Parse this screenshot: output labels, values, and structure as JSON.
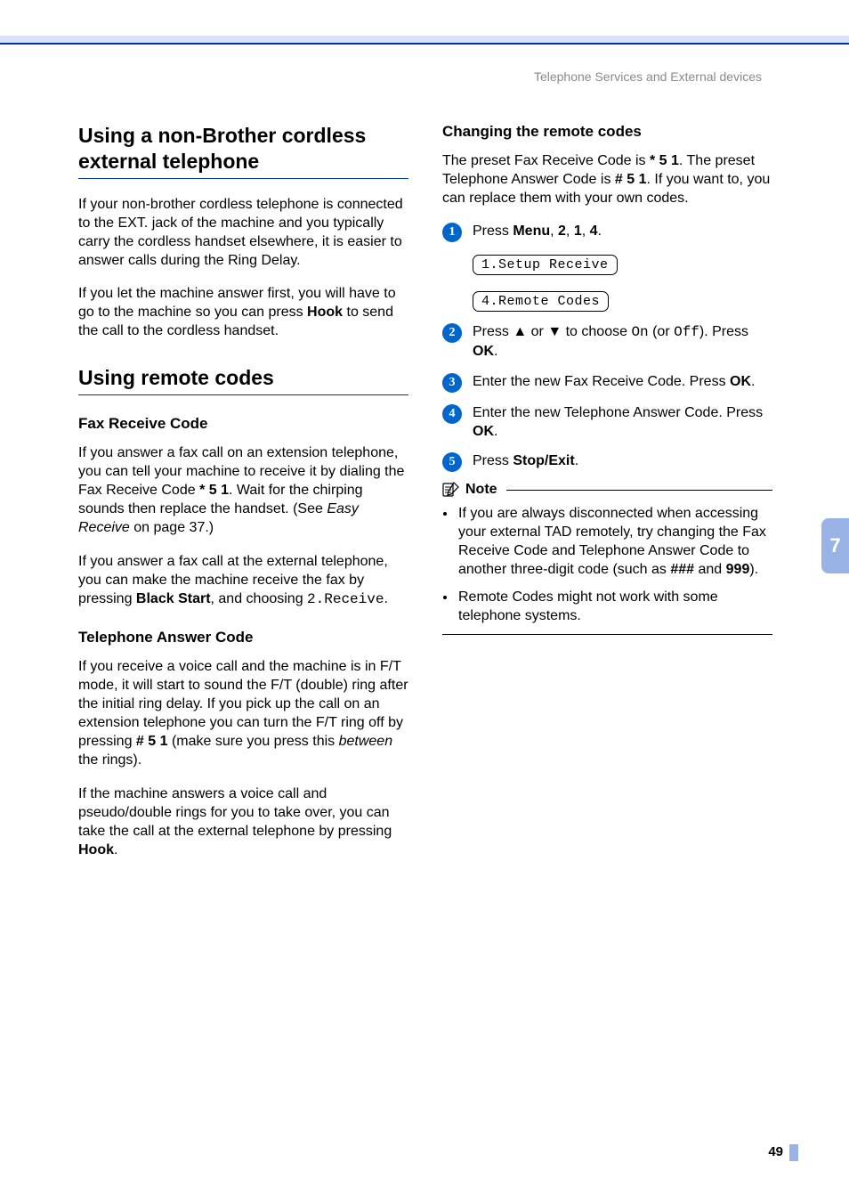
{
  "header": "Telephone Services and External devices",
  "chapter_tab": "7",
  "page_number": "49",
  "left": {
    "h1a": "Using a non-Brother cordless external telephone",
    "p1": "If your non-brother cordless telephone is connected to the EXT. jack of the machine and you typically carry the cordless handset elsewhere, it is easier to answer calls during the Ring Delay.",
    "p2a": "If you let the machine answer first, you will have to go to the machine so you can press ",
    "p2b_bold": "Hook",
    "p2c": " to send the call to the cordless handset.",
    "h1b": "Using remote codes",
    "h2a": "Fax Receive Code",
    "p3a": "If you answer a fax call on an extension telephone, you can tell your machine to receive it by dialing the Fax Receive Code ",
    "p3_code": "* 5 1",
    "p3b": ". Wait for the chirping sounds then replace the handset. (See ",
    "p3_italic": "Easy Receive",
    "p3c": " on page 37.)",
    "p4a": "If you answer a fax call at the external telephone, you can make the machine receive the fax by pressing ",
    "p4_bold": "Black Start",
    "p4b": ", and choosing ",
    "p4_mono": "2.Receive",
    "p4c": ".",
    "h2b": "Telephone Answer Code",
    "p5a": "If you receive a voice call and the machine is in F/T mode, it will start to sound the F/T (double) ring after the initial ring delay. If you pick up the call on an extension telephone you can turn the F/T ring off by pressing ",
    "p5_code": "# 5 1",
    "p5b": " (make sure you press this ",
    "p5_italic": "between",
    "p5c": " the rings).",
    "p6a": "If the machine answers a voice call and pseudo/double rings for you to take over, you can take the call at the external telephone by pressing ",
    "p6_bold": "Hook",
    "p6b": "."
  },
  "right": {
    "h2a": "Changing the remote codes",
    "p1a": "The preset Fax Receive Code is ",
    "p1_code1": "* 5 1",
    "p1b": ". The preset Telephone Answer Code is ",
    "p1_code2": "# 5 1",
    "p1c": ". If you want to, you can replace them with your own codes.",
    "step1a": "Press ",
    "step1_menu": "Menu",
    "step1_comma1": ", ",
    "step1_2": "2",
    "step1_comma2": ", ",
    "step1_1": "1",
    "step1_comma3": ", ",
    "step1_4": "4",
    "step1_dot": ".",
    "lcd1": "1.Setup Receive",
    "lcd2": "4.Remote Codes",
    "step2a": "Press ",
    "step2_up": "▲",
    "step2_or": " or ",
    "step2_down": "▼",
    "step2b": " to choose ",
    "step2_on": "On",
    "step2_oror": " (or ",
    "step2_off": "Off",
    "step2c": "). Press ",
    "step2_ok": "OK",
    "step2_dot": ".",
    "step3a": "Enter the new Fax Receive Code. Press ",
    "step3_ok": "OK",
    "step3_dot": ".",
    "step4a": "Enter the new Telephone Answer Code. Press ",
    "step4_ok": "OK",
    "step4_dot": ".",
    "step5a": "Press ",
    "step5_stop": "Stop/Exit",
    "step5_dot": ".",
    "note_label": "Note",
    "note1a": "If you are always disconnected when accessing your external TAD remotely, try changing the Fax Receive Code and Telephone Answer Code to another three-digit code (such as ",
    "note1_b1": "###",
    "note1_and": " and ",
    "note1_b2": "999",
    "note1_end": ").",
    "note2": "Remote Codes might not work with some telephone systems."
  },
  "badges": {
    "1": "1",
    "2": "2",
    "3": "3",
    "4": "4",
    "5": "5"
  }
}
